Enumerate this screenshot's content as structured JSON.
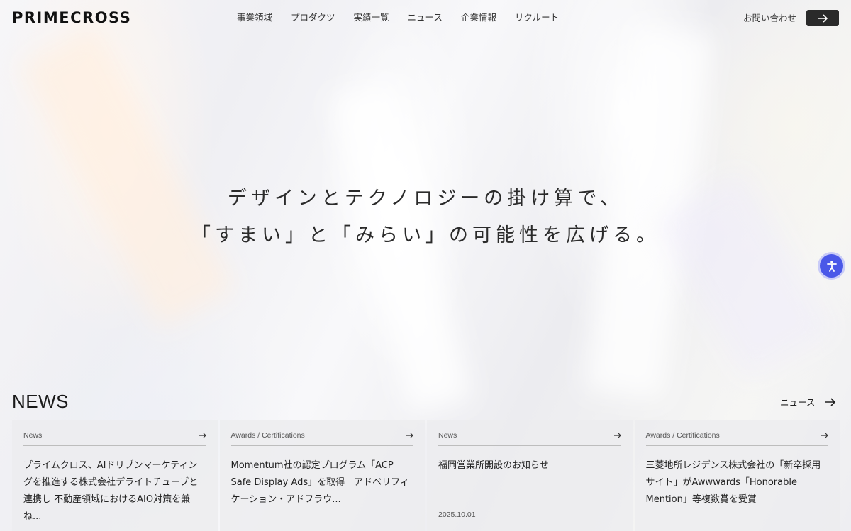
{
  "brand": {
    "logo_text": "PRIMECROSS"
  },
  "nav": {
    "items": [
      {
        "label": "事業領域"
      },
      {
        "label": "プロダクツ"
      },
      {
        "label": "実績一覧"
      },
      {
        "label": "ニュース"
      },
      {
        "label": "企業情報"
      },
      {
        "label": "リクルート"
      }
    ],
    "contact_label": "お問い合わせ"
  },
  "hero": {
    "line1": "デザインとテクノロジーの掛け算で、",
    "line2": "「すまい」と「みらい」の可能性を広げる。"
  },
  "news": {
    "heading": "NEWS",
    "more_label": "ニュース",
    "cards": [
      {
        "category": "News",
        "title": "プライムクロス、AIドリブンマーケティングを推進する株式会社デライトチューブと連携し 不動産領域におけるAIO対策を兼ね...",
        "date": ""
      },
      {
        "category": "Awards / Certifications",
        "title": "Momentum社の認定プログラム「ACP Safe Display Ads」を取得　アドベリフィケーション・アドフラウ...",
        "date": ""
      },
      {
        "category": "News",
        "title": "福岡営業所開設のお知らせ",
        "date": "2025.10.01"
      },
      {
        "category": "Awards / Certifications",
        "title": "三菱地所レジデンス株式会社の「新卒採用サイト」がAwwwards「Honorable Mention」等複数賞を受賞",
        "date": ""
      }
    ]
  },
  "colors": {
    "accent": "#4a58e8",
    "button_dark": "#2a2a2a"
  },
  "icons": {
    "contact": "arrow-right-icon",
    "accessibility": "accessibility-icon"
  }
}
